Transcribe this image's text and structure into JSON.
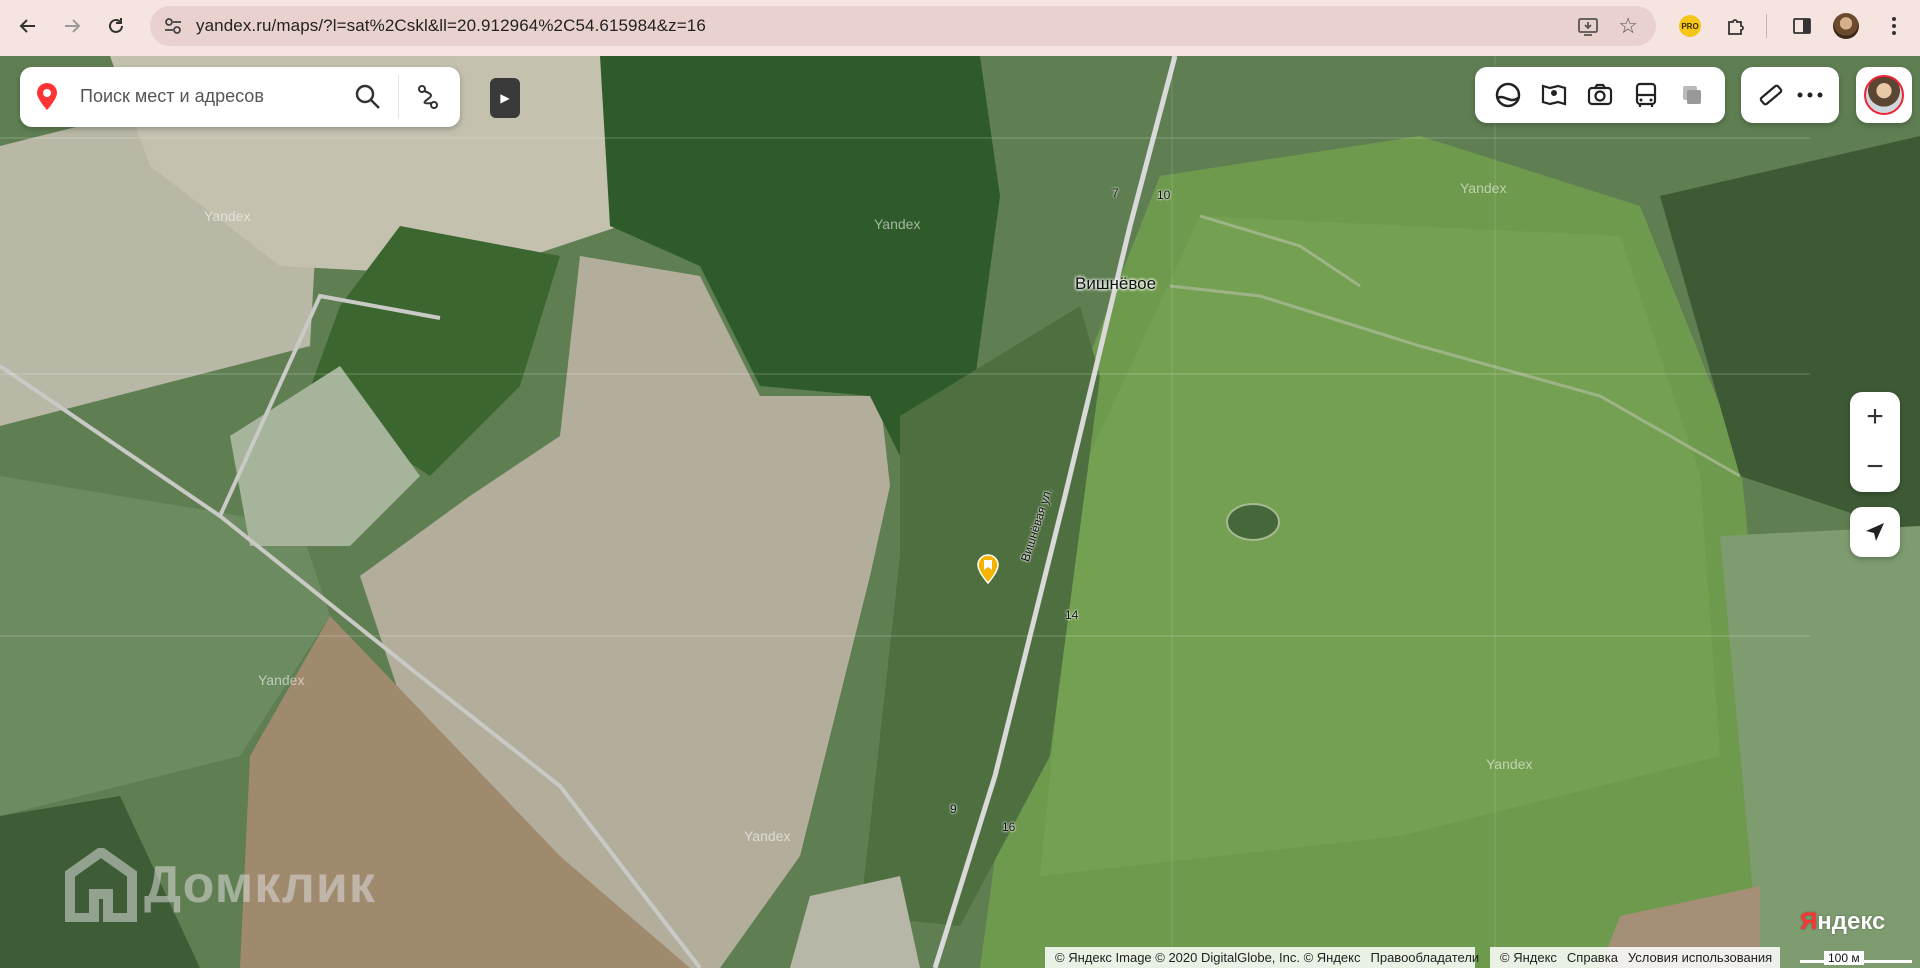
{
  "browser": {
    "url": "yandex.ru/maps/?l=sat%2Cskl&ll=20.912964%2C54.615984&z=16",
    "icons": [
      "back-arrow-icon",
      "forward-arrow-icon",
      "reload-icon",
      "site-settings-icon",
      "install-app-icon",
      "bookmark-star-icon",
      "pro-extension-icon",
      "extensions-puzzle-icon",
      "side-panel-icon",
      "profile-avatar",
      "menu-dots-icon"
    ],
    "pro_badge": "PRO"
  },
  "search": {
    "placeholder": "Поиск мест и адресов"
  },
  "map": {
    "place_label": "Вишнёвое",
    "street_label": "Вишнёвая ул.",
    "house_numbers": [
      "7",
      "10",
      "14",
      "9",
      "16"
    ],
    "watermarks": [
      "Yandex",
      "Yandex",
      "Yandex",
      "Yandex",
      "Yandex",
      "Yandex"
    ],
    "brand_watermark": "Домклик",
    "logo": {
      "first": "Я",
      "rest": "ндекс"
    },
    "scale_label": "100 м"
  },
  "toolbar": {
    "layers_icons": [
      "layers-icon",
      "panorama-icon",
      "photo-camera-icon",
      "transit-bus-icon",
      "layer-toggle-icon"
    ],
    "tools_icons": [
      "ruler-icon",
      "more-dots-icon"
    ]
  },
  "zoom": {
    "plus": "+",
    "minus": "−"
  },
  "copyright": {
    "main": "© Яндекс Image © 2020 DigitalGlobe, Inc. © Яндекс",
    "rights_link": "Правообладатели",
    "yandex": "© Яндекс",
    "help": "Справка",
    "terms": "Условия использования"
  },
  "colors": {
    "chrome_bg": "#f5e4e0",
    "address_bg": "#e9d2cd",
    "pin": "#f5b400",
    "logo_red": "#ff3333"
  }
}
